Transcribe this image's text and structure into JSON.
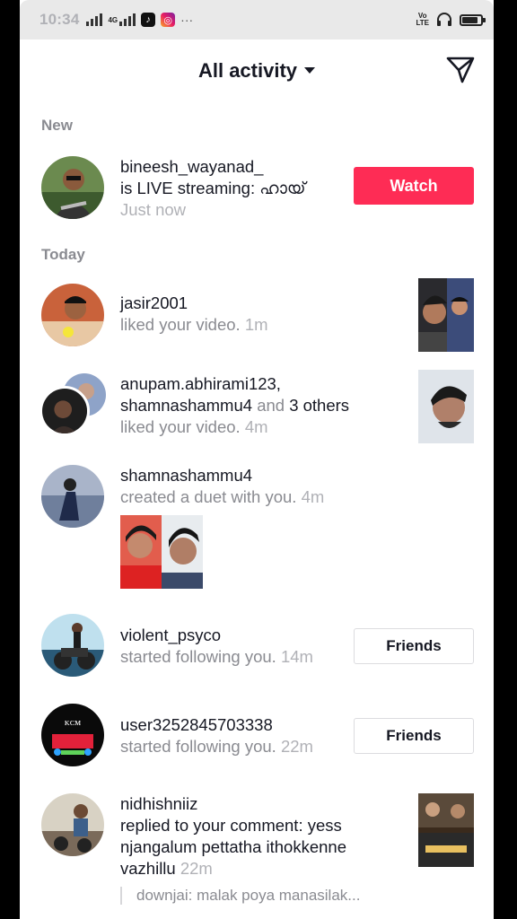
{
  "status_bar": {
    "time": "10:34",
    "network_label": "4G",
    "volte_line1": "Vo",
    "volte_line2": "LTE",
    "battery_fraction": 0.75
  },
  "header": {
    "title": "All activity",
    "send_icon": "send-icon"
  },
  "sections": {
    "new_label": "New",
    "today_label": "Today"
  },
  "live": {
    "username": "bineesh_wayanad_",
    "text": "is LIVE streaming: ഹായ്",
    "time": "Just now",
    "button": "Watch"
  },
  "activities": [
    {
      "username": "jasir2001",
      "action": "liked your video.",
      "time": "1m"
    },
    {
      "username": "anupam.abhirami123,",
      "username2": "shamnashammu4",
      "and": "and",
      "others": "3 others",
      "action": "liked your video.",
      "time": "4m"
    },
    {
      "username": "shamnashammu4",
      "action": "created a duet with you.",
      "time": "4m"
    },
    {
      "username": "violent_psyco",
      "action": "started following you.",
      "time": "14m",
      "button": "Friends"
    },
    {
      "username": "user3252845703338",
      "action": "started following you.",
      "time": "22m",
      "button": "Friends"
    },
    {
      "username": "nidhishniiz",
      "action_line1": "replied to your comment: yess",
      "action_line2": "njangalum pettatha ithokkenne",
      "action_line3": "vazhillu",
      "time": "22m",
      "quote": "downjai: malak poya manasilak..."
    }
  ],
  "colors": {
    "accent": "#fe2c55",
    "secondary_text": "#8a8b91",
    "primary_text": "#161823"
  }
}
